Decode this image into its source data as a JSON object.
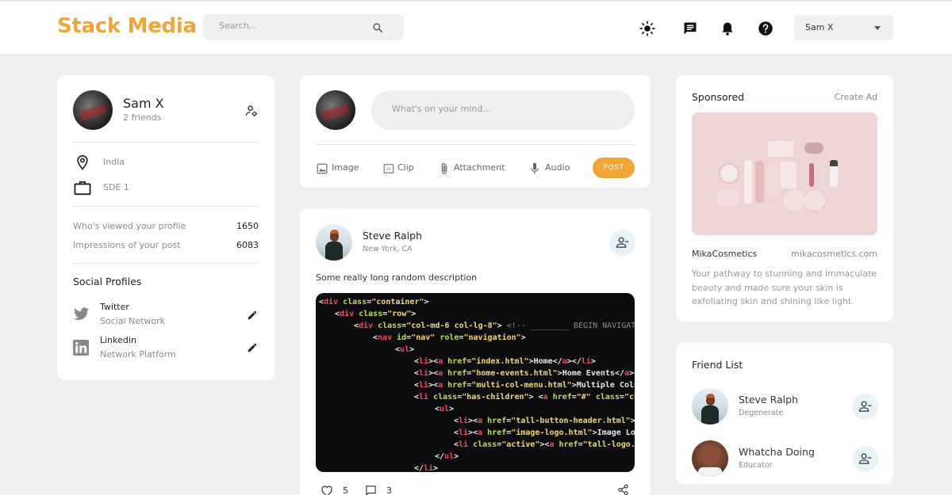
{
  "header": {
    "logo": "Stack Media",
    "search_placeholder": "Search...",
    "user_name": "Sam X",
    "icons": [
      "light-mode-icon",
      "message-icon",
      "notification-icon",
      "help-icon"
    ],
    "colors": {
      "brand": "#f0a535",
      "background": "#f0f0f0",
      "icon_bubble": "#e6f4fa"
    }
  },
  "profile": {
    "name": "Sam X",
    "friends": "2 friends",
    "location": "India",
    "occupation": "SDE 1",
    "stats": [
      {
        "label": "Who's viewed your profile",
        "value": "1650"
      },
      {
        "label": "Impressions of your post",
        "value": "6083"
      }
    ],
    "social_title": "Social Profiles",
    "socials": [
      {
        "name": "Twitter",
        "sub": "Social Network",
        "icon": "twitter-icon"
      },
      {
        "name": "Linkedin",
        "sub": "Network Platform",
        "icon": "linkedin-icon"
      }
    ]
  },
  "composer": {
    "placeholder": "What's on your mind...",
    "actions": [
      {
        "label": "Image",
        "icon": "image-icon"
      },
      {
        "label": "Clip",
        "icon": "gif-icon"
      },
      {
        "label": "Attachment",
        "icon": "attachment-icon"
      },
      {
        "label": "Audio",
        "icon": "mic-icon"
      }
    ],
    "post_label": "POST"
  },
  "post": {
    "author": "Steve Ralph",
    "location": "New York, CA",
    "description": "Some really long random description",
    "likes": "5",
    "comments": "3"
  },
  "sponsored": {
    "title": "Sponsored",
    "create_ad": "Create Ad",
    "brand": "MikaCosmetics",
    "url": "mikacosmetics.com",
    "text": "Your pathway to stunning and immaculate beauty and made sure your skin is exfoliating skin and shining like light."
  },
  "friends": {
    "title": "Friend List",
    "items": [
      {
        "name": "Steve Ralph",
        "role": "Degenerate"
      },
      {
        "name": "Whatcha Doing",
        "role": "Educator"
      }
    ]
  }
}
